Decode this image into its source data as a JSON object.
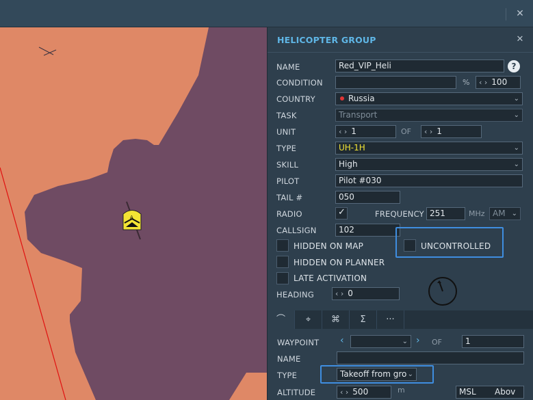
{
  "window": {
    "close_label": "✕"
  },
  "map": {
    "unit_marker": "A"
  },
  "panel": {
    "title": "HELICOPTER GROUP",
    "close_label": "✕",
    "help_label": "?",
    "name": {
      "label": "NAME",
      "value": "Red_VIP_Heli"
    },
    "condition": {
      "label": "CONDITION",
      "value": "",
      "percent_sign": "%",
      "percent_value": "100"
    },
    "country": {
      "label": "COUNTRY",
      "value": "Russia",
      "marker_color": "#e03535"
    },
    "task": {
      "label": "TASK",
      "value": "Transport"
    },
    "unit": {
      "label": "UNIT",
      "value": "1",
      "of_label": "OF",
      "total": "1"
    },
    "type": {
      "label": "TYPE",
      "value": "UH-1H"
    },
    "skill": {
      "label": "SKILL",
      "value": "High"
    },
    "pilot": {
      "label": "PILOT",
      "value": "Pilot #030"
    },
    "tail": {
      "label": "TAIL #",
      "value": "050"
    },
    "radio": {
      "label": "RADIO",
      "checked": true,
      "frequency_label": "FREQUENCY",
      "frequency_value": "251",
      "unit": "MHz",
      "modulation": "AM"
    },
    "callsign": {
      "label": "CALLSIGN",
      "value": "102"
    },
    "hidden_on_map": {
      "label": "HIDDEN ON MAP",
      "checked": false
    },
    "uncontrolled": {
      "label": "UNCONTROLLED",
      "checked": false
    },
    "hidden_on_planner": {
      "label": "HIDDEN ON PLANNER",
      "checked": false
    },
    "late_activation": {
      "label": "LATE ACTIVATION",
      "checked": false
    },
    "heading": {
      "label": "HEADING",
      "value": "0"
    }
  },
  "tabs": [
    {
      "icon": "route-icon",
      "glyph": "⌒"
    },
    {
      "icon": "target-icon",
      "glyph": "⌖"
    },
    {
      "icon": "nodes-icon",
      "glyph": "⌘"
    },
    {
      "icon": "sigma-icon",
      "glyph": "Σ"
    },
    {
      "icon": "more-icon",
      "glyph": "···"
    }
  ],
  "waypoint": {
    "label": "WAYPOINT",
    "value": "",
    "of_label": "OF",
    "total": "1",
    "name_label": "NAME",
    "name_value": "",
    "type_label": "TYPE",
    "type_value": "Takeoff from gro",
    "altitude_label": "ALTITUDE",
    "altitude_value": "500",
    "altitude_unit": "m",
    "altitude_ref": "MSL",
    "altitude_mode": "Abov"
  },
  "colors": {
    "accent": "#5fb6e6",
    "terrain": "#df8866",
    "zone": "#6f4b63",
    "highlight": "#3f8ee0"
  }
}
